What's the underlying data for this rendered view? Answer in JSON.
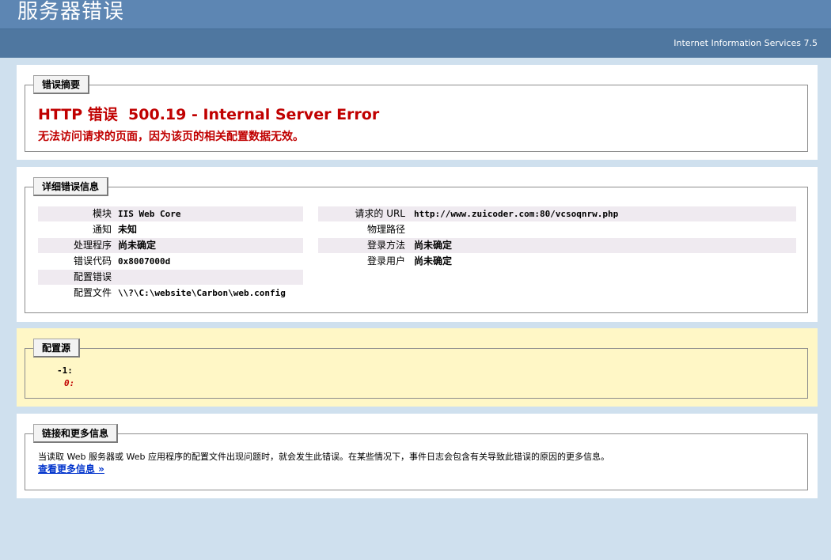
{
  "header": {
    "title": "服务器错误",
    "iis": "Internet Information Services 7.5"
  },
  "summary": {
    "legend": "错误摘要",
    "title": "HTTP 错误  500.19 - Internal Server Error",
    "description": "无法访问请求的页面，因为该页的相关配置数据无效。"
  },
  "detail": {
    "legend": "详细错误信息",
    "left": [
      {
        "label": "模块",
        "value": "IIS Web Core"
      },
      {
        "label": "通知",
        "value": "未知"
      },
      {
        "label": "处理程序",
        "value": "尚未确定"
      },
      {
        "label": "错误代码",
        "value": "0x8007000d"
      },
      {
        "label": "配置错误",
        "value": ""
      },
      {
        "label": "配置文件",
        "value": "\\\\?\\C:\\website\\Carbon\\web.config"
      }
    ],
    "right": [
      {
        "label": "请求的 URL",
        "value": "http://www.zuicoder.com:80/vcsoqnrw.php"
      },
      {
        "label": "物理路径",
        "value": ""
      },
      {
        "label": "登录方法",
        "value": "尚未确定"
      },
      {
        "label": "登录用户",
        "value": "尚未确定"
      }
    ]
  },
  "config_source": {
    "legend": "配置源",
    "lines": [
      "-1:",
      "0:"
    ]
  },
  "more_info": {
    "legend": "链接和更多信息",
    "text": "当读取 Web 服务器或 Web 应用程序的配置文件出现问题时，就会发生此错误。在某些情况下，事件日志会包含有关导致此错误的原因的更多信息。",
    "link": "查看更多信息 »"
  },
  "colors": {
    "error_red": "#c00000",
    "header_blue": "#5d86b3",
    "link_blue": "#0033cc"
  }
}
